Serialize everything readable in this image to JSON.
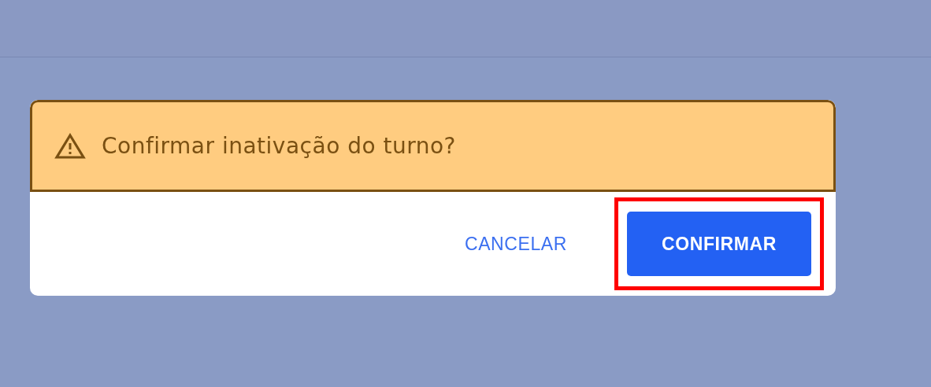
{
  "dialog": {
    "title": "Confirmar inativação do turno?",
    "buttons": [
      {
        "label": "CANCELAR",
        "kind": "text",
        "highlighted": false
      },
      {
        "label": "CONFIRMAR",
        "kind": "primary",
        "highlighted": true
      }
    ]
  }
}
